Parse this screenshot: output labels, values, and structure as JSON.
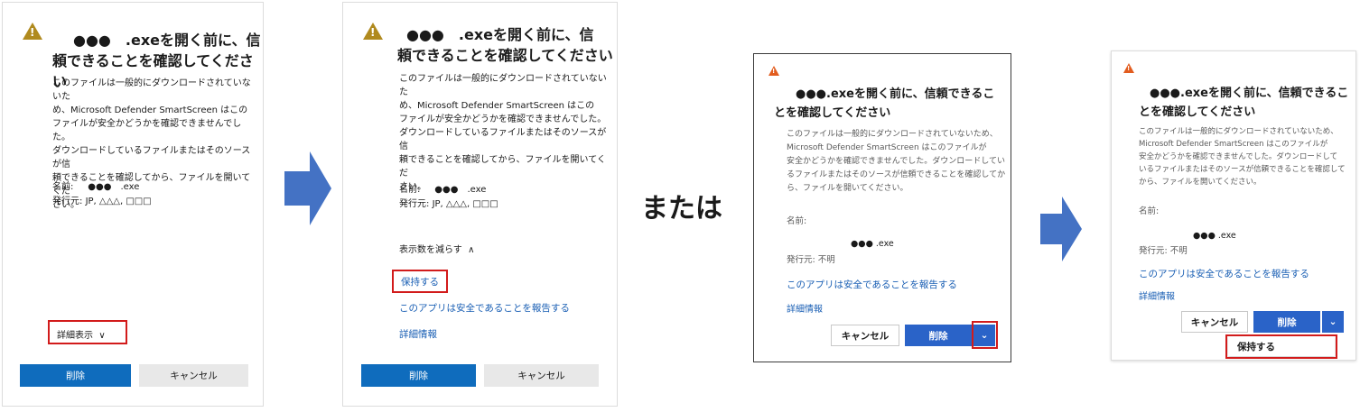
{
  "panel1": {
    "title_l1": "●●●　.exeを開く前に、信",
    "title_l2": "頼できることを確認してください",
    "body": [
      "このファイルは一般的にダウンロードされていないた",
      "め、Microsoft Defender SmartScreen はこの",
      "ファイルが安全かどうかを確認できませんでした。",
      "ダウンロードしているファイルまたはそのソースが信",
      "頼できることを確認してから、ファイルを開いてくだ",
      "さい。"
    ],
    "name_label": "名前:",
    "name_value": "●●●　.exe",
    "publisher_label": "発行元:",
    "publisher_value": "JP, △△△, □□□",
    "details_toggle": "詳細表示",
    "delete_button": "削除",
    "cancel_button": "キャンセル"
  },
  "panel2": {
    "title_l1": "●●●　.exeを開く前に、信",
    "title_l2": "頼できることを確認してください",
    "body": [
      "このファイルは一般的にダウンロードされていないた",
      "め、Microsoft Defender SmartScreen はこの",
      "ファイルが安全かどうかを確認できませんでした。",
      "ダウンロードしているファイルまたはそのソースが信",
      "頼できることを確認してから、ファイルを開いてくだ",
      "さい。"
    ],
    "name_label": "名前:",
    "name_value": "●●●　.exe",
    "publisher_label": "発行元:",
    "publisher_value": "JP, △△△, □□□",
    "less_toggle": "表示数を減らす",
    "keep_link": "保持する",
    "report_link": "このアプリは安全であることを報告する",
    "more_info_link": "詳細情報",
    "delete_button": "削除",
    "cancel_button": "キャンセル"
  },
  "or_text": "または",
  "panel3": {
    "title_l1": "●●●.exeを開く前に、信頼できるこ",
    "title_l2": "とを確認してください",
    "body": [
      "このファイルは一般的にダウンロードされていないため、",
      "Microsoft Defender SmartScreen はこのファイルが",
      "安全かどうかを確認できませんでした。ダウンロードしてい",
      "るファイルまたはそのソースが信頼できることを確認してか",
      "ら、ファイルを開いてください。"
    ],
    "name_label": "名前:",
    "name_value": "●●● .exe",
    "publisher": "発行元: 不明",
    "report_link": "このアプリは安全であることを報告する",
    "more_info_link": "詳細情報",
    "cancel_button": "キャンセル",
    "delete_button": "削除",
    "dropdown": "⌄"
  },
  "panel4": {
    "title_l1": "●●●.exeを開く前に、信頼できるこ",
    "title_l2": "とを確認してください",
    "body": [
      "このファイルは一般的にダウンロードされていないため、",
      "Microsoft Defender SmartScreen はこのファイルが",
      "安全かどうかを確認できませんでした。ダウンロードして",
      "いるファイルまたはそのソースが信頼できることを確認して",
      "から、ファイルを開いてください。"
    ],
    "name_label": "名前:",
    "name_value": "●●● .exe",
    "publisher": "発行元: 不明",
    "report_link": "このアプリは安全であることを報告する",
    "more_info_link": "詳細情報",
    "cancel_button": "キャンセル",
    "delete_button": "削除",
    "dropdown": "⌄",
    "keep_menu_item": "保持する"
  },
  "colors": {
    "accent": "#0f6cbd",
    "link": "#1a5fb4",
    "highlight": "#d21b1b",
    "arrow": "#4472c4",
    "warning": "#b08a1e"
  }
}
